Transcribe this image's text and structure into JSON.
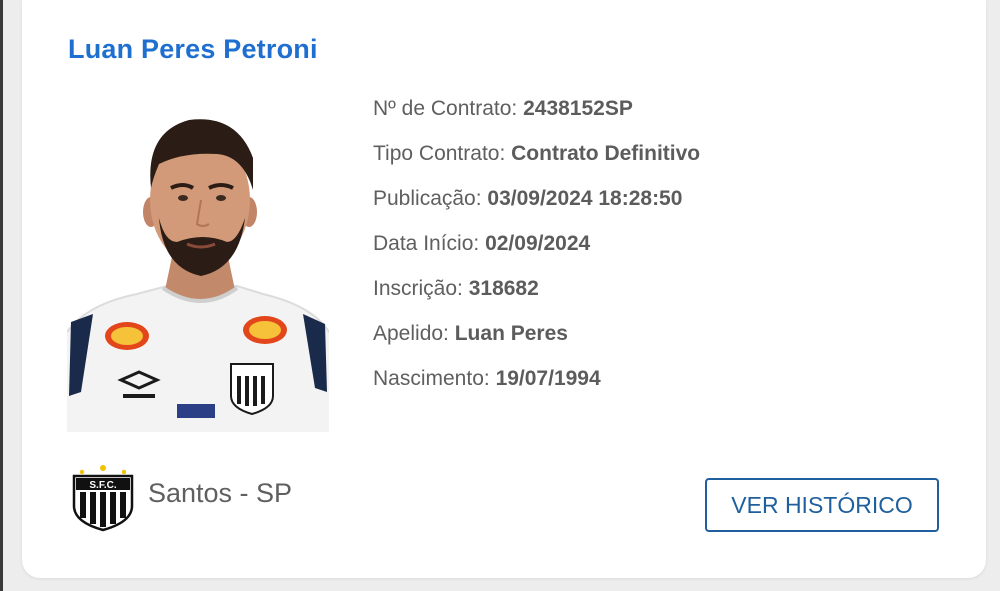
{
  "player": {
    "name": "Luan Peres Petroni"
  },
  "details": [
    {
      "label": "Nº de Contrato:",
      "value": "2438152SP"
    },
    {
      "label": "Tipo Contrato:",
      "value": "Contrato Definitivo"
    },
    {
      "label": "Publicação:",
      "value": "03/09/2024 18:28:50"
    },
    {
      "label": "Data Início:",
      "value": "02/09/2024"
    },
    {
      "label": "Inscrição:",
      "value": "318682"
    },
    {
      "label": "Apelido:",
      "value": "Luan Peres"
    },
    {
      "label": "Nascimento:",
      "value": "19/07/1994"
    }
  ],
  "club": {
    "name": "Santos - SP",
    "logo_icon": "santos-crest-icon",
    "logo_text": "S.F.C."
  },
  "actions": {
    "history_label": "VER HISTÓRICO"
  },
  "colors": {
    "name_blue": "#1f6fd1",
    "button_blue": "#1f5f9e",
    "text_gray": "#5f5f5f"
  }
}
